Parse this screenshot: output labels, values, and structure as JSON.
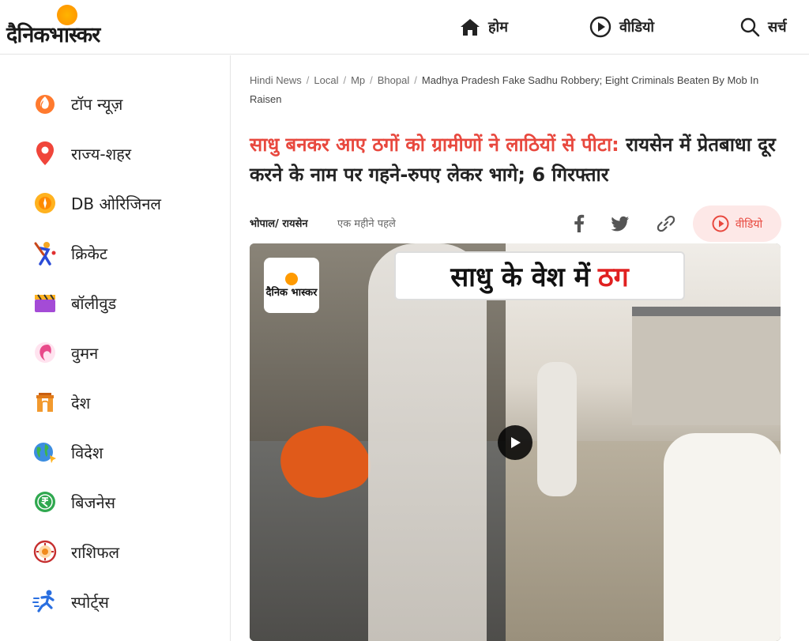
{
  "header": {
    "logo_text": "दैनिकभास्कर",
    "nav": {
      "home": "होम",
      "video": "वीडियो",
      "search": "सर्च"
    }
  },
  "sidebar": {
    "items": [
      {
        "label": "टॉप न्यूज़",
        "icon": "fire-icon"
      },
      {
        "label": "राज्य-शहर",
        "icon": "location-pin-icon"
      },
      {
        "label": "DB ओरिजिनल",
        "icon": "db-original-icon"
      },
      {
        "label": "क्रिकेट",
        "icon": "cricket-icon"
      },
      {
        "label": "बॉलीवुड",
        "icon": "clapperboard-icon"
      },
      {
        "label": "वुमन",
        "icon": "woman-icon"
      },
      {
        "label": "देश",
        "icon": "india-gate-icon"
      },
      {
        "label": "विदेश",
        "icon": "globe-icon"
      },
      {
        "label": "बिजनेस",
        "icon": "rupee-icon"
      },
      {
        "label": "राशिफल",
        "icon": "horoscope-icon"
      },
      {
        "label": "स्पोर्ट्स",
        "icon": "runner-icon"
      }
    ]
  },
  "breadcrumb": {
    "items": [
      "Hindi News",
      "Local",
      "Mp",
      "Bhopal"
    ],
    "current": "Madhya Pradesh Fake Sadhu Robbery; Eight Criminals Beaten By Mob In Raisen"
  },
  "article": {
    "headline_highlight": "साधु बनकर आए ठगों को ग्रामीणों ने लाठियों से पीटा:",
    "headline_rest": " रायसेन में प्रेतबाधा दूर करने के नाम पर गहने-रुपए लेकर भागे; 6 गिरफ्तार",
    "location": "भोपाल/ रायसेन",
    "time": "एक महीने पहले",
    "video_button": "वीडियो"
  },
  "video": {
    "banner_text": "साधु के वेश में",
    "banner_highlight": "ठग",
    "logo_text": "दैनिक भास्कर"
  },
  "colors": {
    "accent_red": "#e8483e",
    "brand_orange": "#ff9a00"
  }
}
